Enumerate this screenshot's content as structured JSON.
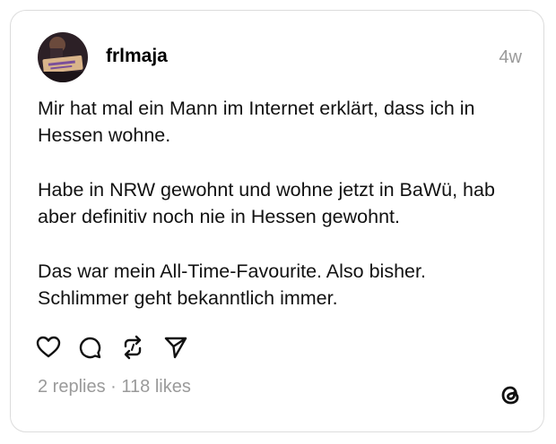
{
  "post": {
    "author": {
      "username": "frlmaja",
      "avatar_icon": "profile-photo"
    },
    "timestamp": "4w",
    "paragraphs": [
      "Mir hat mal ein Mann im Internet erklärt, dass ich in\nHessen wohne.",
      "Habe in NRW gewohnt und wohne jetzt in BaWü, hab\naber definitiv noch nie in Hessen gewohnt.",
      "Das war mein All-Time-Favourite. Also bisher.\nSchlimmer geht bekanntlich immer."
    ],
    "actions": [
      {
        "name": "like",
        "icon": "heart-icon"
      },
      {
        "name": "reply",
        "icon": "comment-bubble-icon"
      },
      {
        "name": "repost",
        "icon": "repost-icon"
      },
      {
        "name": "share",
        "icon": "send-icon"
      }
    ],
    "stats": {
      "replies": "2 replies",
      "separator": "·",
      "likes": "118 likes"
    }
  },
  "branding": {
    "logo": "threads-logo-icon"
  },
  "colors": {
    "text": "#111111",
    "muted": "#9a9a9a",
    "border": "#dcdcdc",
    "background": "#ffffff"
  }
}
